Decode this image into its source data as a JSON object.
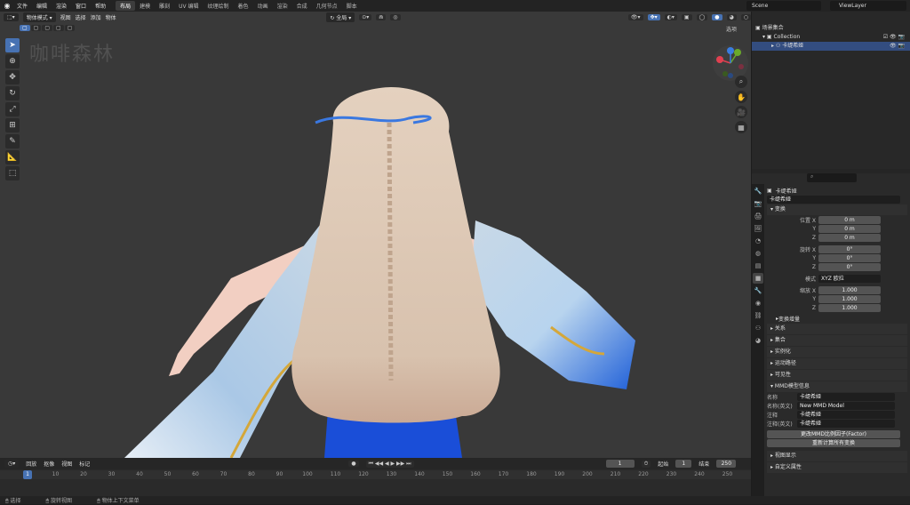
{
  "menubar": {
    "menus": [
      "文件",
      "编辑",
      "渲染",
      "窗口",
      "帮助"
    ],
    "workspaces": [
      "布局",
      "建模",
      "雕刻",
      "UV 编辑",
      "纹理绘制",
      "着色",
      "动画",
      "渲染",
      "合成",
      "几何节点",
      "脚本"
    ],
    "active_workspace": 0,
    "scene": "Scene",
    "view_layer": "ViewLayer"
  },
  "viewport": {
    "mode": "物体模式",
    "menus": [
      "视图",
      "选择",
      "添加",
      "物体"
    ],
    "transform_orientation": "全局",
    "options_label": "选项",
    "watermark": "咖啡森林"
  },
  "outliner": {
    "scene_collection": "场景集合",
    "collection": "Collection",
    "object": "卡缇希娅"
  },
  "properties": {
    "object_name": "卡缇希娅",
    "object_data_name": "卡缇希娅",
    "transform_label": "变换",
    "location_label": "位置",
    "rotation_label": "旋转",
    "mode_label": "模式",
    "scale_label": "缩放",
    "axis_x": "X",
    "axis_y": "Y",
    "axis_z": "Z",
    "location": [
      "0 m",
      "0 m",
      "0 m"
    ],
    "rotation": [
      "0°",
      "0°",
      "0°"
    ],
    "rotation_mode": "XYZ 欧拉",
    "scale": [
      "1.000",
      "1.000",
      "1.000"
    ],
    "delta_transform": "变换增量",
    "panels": [
      "关系",
      "集合",
      "实例化",
      "运动路径",
      "可见性"
    ],
    "mmd": {
      "header": "MMD模型信息",
      "name_label": "名称",
      "name_value": "卡缇希娅",
      "name_e_label": "名称(英文)",
      "name_e_value": "New MMD Model",
      "comment_label": "注释",
      "comment_value": "卡缇希娅",
      "comment_e_label": "注释(英文)",
      "comment_e_value": "卡缇希娅",
      "button1": "更改MMD比例因子(Factor)",
      "button2": "重新计算所有变换"
    },
    "bottom_panels": [
      "视图显示",
      "自定义属性"
    ]
  },
  "timeline": {
    "menus": [
      "回放",
      "抠像",
      "视图",
      "标记"
    ],
    "current_frame": "1",
    "start_label": "起始",
    "start": "1",
    "end_label": "结束",
    "end": "250",
    "ruler": [
      "1",
      "10",
      "20",
      "30",
      "40",
      "50",
      "60",
      "70",
      "80",
      "90",
      "100",
      "110",
      "120",
      "130",
      "140",
      "150",
      "160",
      "170",
      "180",
      "190",
      "200",
      "210",
      "220",
      "230",
      "240",
      "250"
    ]
  },
  "status": {
    "items": [
      "选择",
      "旋转视图",
      "物体上下文菜单"
    ]
  }
}
